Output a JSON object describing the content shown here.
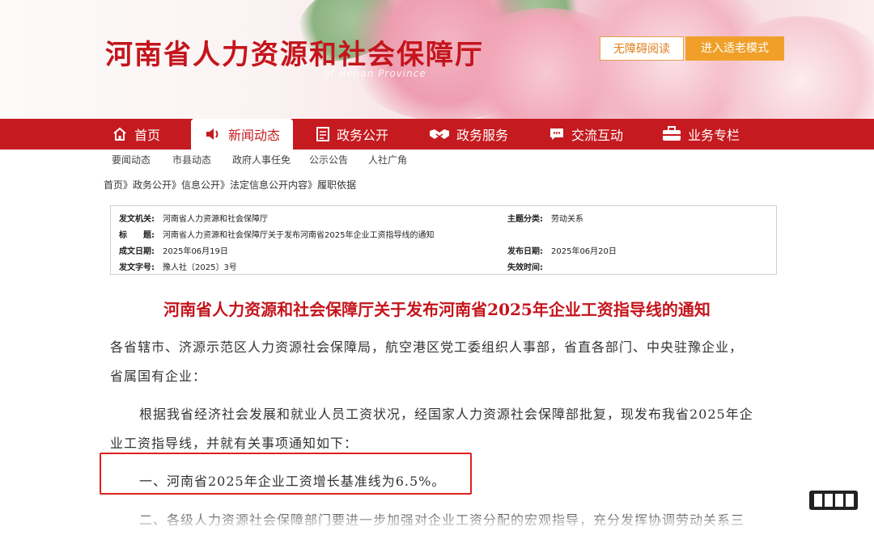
{
  "header": {
    "site_title": "河南省人力资源和社会保障厅",
    "site_subtitle": "of Henan Province",
    "accessibility_button": "无障碍阅读",
    "elderly_mode_button": "进入适老模式"
  },
  "nav": {
    "items": [
      {
        "label": "首页",
        "icon": "home-icon"
      },
      {
        "label": "新闻动态",
        "icon": "speaker-icon",
        "active": true
      },
      {
        "label": "政务公开",
        "icon": "document-icon"
      },
      {
        "label": "政务服务",
        "icon": "handshake-icon"
      },
      {
        "label": "交流互动",
        "icon": "chat-icon"
      },
      {
        "label": "业务专栏",
        "icon": "briefcase-icon"
      }
    ]
  },
  "subnav": {
    "items": [
      "要闻动态",
      "市县动态",
      "政府人事任免",
      "公示公告",
      "人社广角"
    ]
  },
  "breadcrumb": "首页》政务公开》信息公开》法定信息公开内容》履职依据",
  "info": {
    "issuer_label": "发文机关:",
    "issuer": "河南省人力资源和社会保障厅",
    "category_label": "主题分类:",
    "category": "劳动关系",
    "title_label": "标　　题:",
    "title": "河南省人力资源和社会保障厅关于发布河南省2025年企业工资指导线的通知",
    "written_label": "成文日期:",
    "written": "2025年06月19日",
    "published_label": "发布日期:",
    "published": "2025年06月20日",
    "docno_label": "发文字号:",
    "docno": "豫人社〔2025〕3号",
    "expiry_label": "失效时间:",
    "expiry": ""
  },
  "article": {
    "title": "河南省人力资源和社会保障厅关于发布河南省2025年企业工资指导线的通知",
    "recipients_line1": "各省辖市、济源示范区人力资源社会保障局，航空港区党工委组织人事部，省直各部门、中央驻豫企业，",
    "recipients_line2": "省属国有企业：",
    "intro_line1": "根据我省经济社会发展和就业人员工资状况，经国家人力资源社会保障部批复，现发布我省2025年企",
    "intro_line2": "业工资指导线，并就有关事项通知如下：",
    "point1": "一、河南省2025年企业工资增长基准线为6.5%。",
    "point2": "二、各级人力资源社会保障部门要进一步加强对企业工资分配的宏观指导，充分发挥协调劳动关系三"
  },
  "colors": {
    "brand_red": "#c51a1f",
    "title_red": "#c4151c",
    "accent_orange": "#f0a028"
  }
}
